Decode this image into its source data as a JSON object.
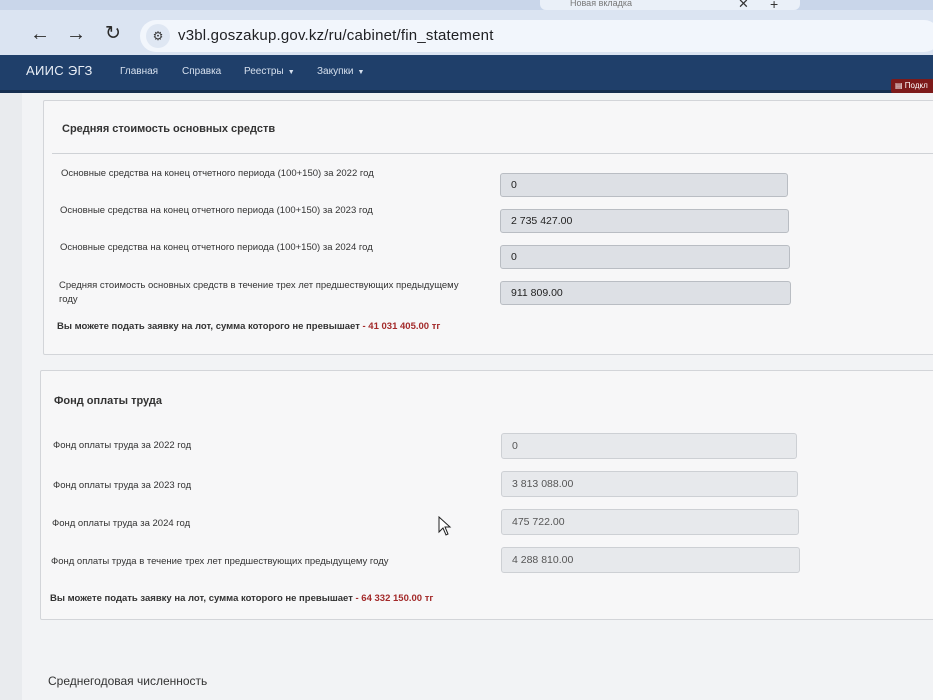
{
  "browser": {
    "tab_title": "Новая вкладка",
    "url": "v3bl.goszakup.gov.kz/ru/cabinet/fin_statement"
  },
  "navbar": {
    "brand": "АИИС ЭГЗ",
    "items": [
      "Главная",
      "Справка",
      "Реестры",
      "Закупки"
    ],
    "action_label": "Подкл"
  },
  "fixed_assets": {
    "title": "Средняя стоимость основных средств",
    "rows": [
      {
        "label": "Основные средства на конец отчетного периода (100+150) за 2022 год",
        "value": "0"
      },
      {
        "label": "Основные средства на конец отчетного периода (100+150) за 2023 год",
        "value": "2 735 427.00"
      },
      {
        "label": "Основные средства на конец отчетного периода (100+150) за 2024 год",
        "value": "0"
      },
      {
        "label": "Средняя стоимость основных средств в течение трех лет предшествующих предыдущему году",
        "value": "911 809.00"
      }
    ],
    "limit_text": "Вы можете подать заявку на лот, сумма которого не превышает",
    "limit_amount": "- 41 031 405.00 тг"
  },
  "payroll": {
    "title": "Фонд оплаты труда",
    "rows": [
      {
        "label": "Фонд оплаты труда за 2022 год",
        "value": "0"
      },
      {
        "label": "Фонд оплаты труда за 2023 год",
        "value": "3 813 088.00"
      },
      {
        "label": "Фонд оплаты труда за 2024 год",
        "value": "475 722.00"
      },
      {
        "label": "Фонд оплаты труда в течение трех лет предшествующих предыдущему году",
        "value": "4 288 810.00"
      }
    ],
    "limit_text": "Вы можете подать заявку на лот, сумма которого не превышает",
    "limit_amount": "- 64 332 150.00 тг"
  },
  "headcount": {
    "title": "Среднегодовая численность"
  }
}
